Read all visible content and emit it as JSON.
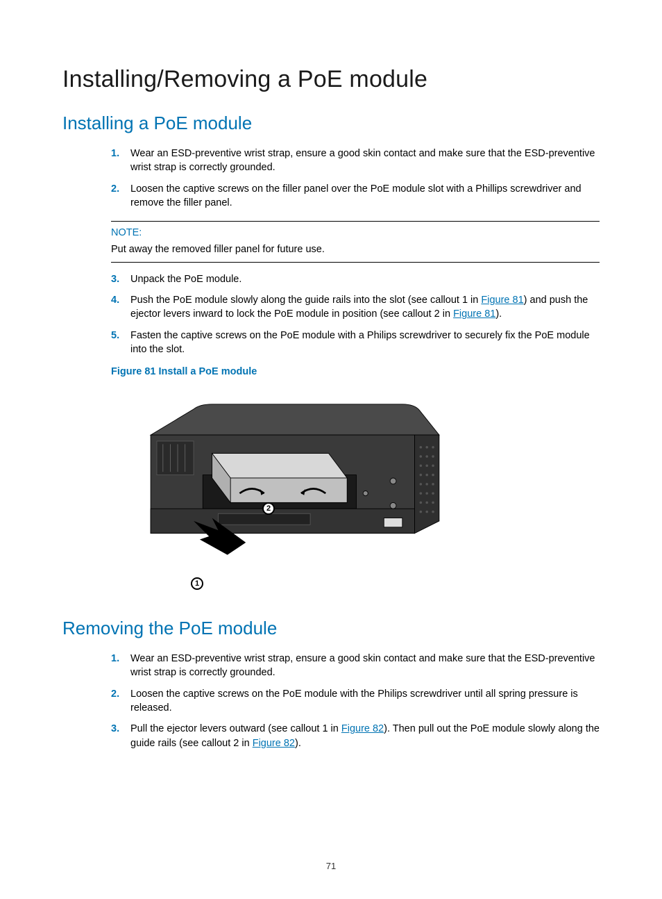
{
  "title": "Installing/Removing a PoE module",
  "section1": {
    "heading": "Installing a PoE module",
    "steps": [
      {
        "n": "1.",
        "t": "Wear an ESD-preventive wrist strap, ensure a good skin contact and make sure that the ESD-preventive wrist strap is correctly grounded."
      },
      {
        "n": "2.",
        "t": "Loosen the captive screws on the filler panel over the PoE module slot with a Phillips screwdriver and remove the filler panel."
      }
    ],
    "note_label": "NOTE:",
    "note_text": "Put away the removed filler panel for future use.",
    "steps_after": [
      {
        "n": "3.",
        "t": "Unpack the PoE module."
      },
      {
        "n": "4.",
        "pre": "Push the PoE module slowly along the guide rails into the slot (see callout 1 in ",
        "link1": "Figure 81",
        "mid": ") and push the ejector levers inward to lock the PoE module in position (see callout 2 in ",
        "link2": "Figure 81",
        "post": ")."
      },
      {
        "n": "5.",
        "t": "Fasten the captive screws on the PoE module with a Philips screwdriver to securely fix the PoE module into the slot."
      }
    ],
    "figure_caption": "Figure 81 Install a PoE module",
    "callout1": "1",
    "callout2": "2"
  },
  "section2": {
    "heading": "Removing the PoE module",
    "steps": [
      {
        "n": "1.",
        "t": "Wear an ESD-preventive wrist strap, ensure a good skin contact and make sure that the ESD-preventive wrist strap is correctly grounded."
      },
      {
        "n": "2.",
        "t": "Loosen the captive screws on the PoE module with the Philips screwdriver until all spring pressure is released."
      },
      {
        "n": "3.",
        "pre": "Pull the ejector levers outward (see callout 1 in ",
        "link1": "Figure 82",
        "mid": "). Then pull out the PoE module slowly along the guide rails (see callout 2 in ",
        "link2": "Figure 82",
        "post": ")."
      }
    ]
  },
  "page_number": "71"
}
